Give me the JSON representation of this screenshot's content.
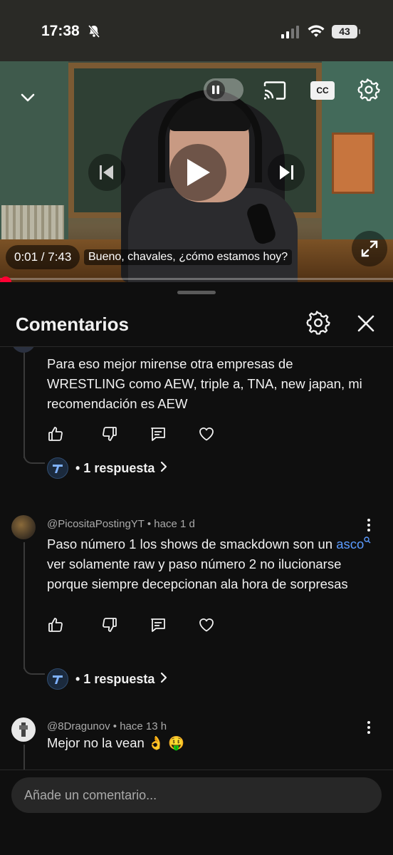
{
  "status_bar": {
    "time": "17:38",
    "battery": "43",
    "icons": [
      "bell-muted-icon",
      "signal-icon",
      "wifi-icon",
      "battery-icon"
    ]
  },
  "player": {
    "time_readout": "0:01 / 7:43",
    "caption": "Bueno, chavales, ¿cómo estamos hoy?",
    "progress": 0.002,
    "cc_label": "CC",
    "icons": [
      "chevron-down-icon",
      "pause-icon",
      "cast-icon",
      "cc-icon",
      "gear-icon",
      "previous-icon",
      "play-icon",
      "next-icon",
      "fullscreen-icon"
    ],
    "accent": "#ff0033"
  },
  "sheet": {
    "title": "Comentarios",
    "icons": [
      "gear-icon",
      "close-icon"
    ]
  },
  "comments": [
    {
      "author": "",
      "time": "",
      "text": "Para eso mejor mirense otra empresas de WRESTLING como AEW, triple a,  TNA, new japan, mi recomendación es AEW",
      "replies": "• 1 respuesta"
    },
    {
      "author": "@PicositaPostingYT",
      "time": "hace 1 d",
      "text_before": "Paso número 1 los shows de smackdown son un ",
      "link": "asco",
      "text_after": " ver solamente raw y paso número 2 no ilucionarse porque siempre decepcionan ala hora de sorpresas",
      "replies": "• 1 respuesta"
    },
    {
      "author": "@8Dragunov",
      "time": "hace 13 h",
      "text": "Mejor no la vean 👌 🤑"
    }
  ],
  "actions": {
    "icons": [
      "thumbs-up-icon",
      "thumbs-down-icon",
      "reply-icon",
      "heart-icon"
    ]
  },
  "composer": {
    "placeholder": "Añade un comentario..."
  }
}
